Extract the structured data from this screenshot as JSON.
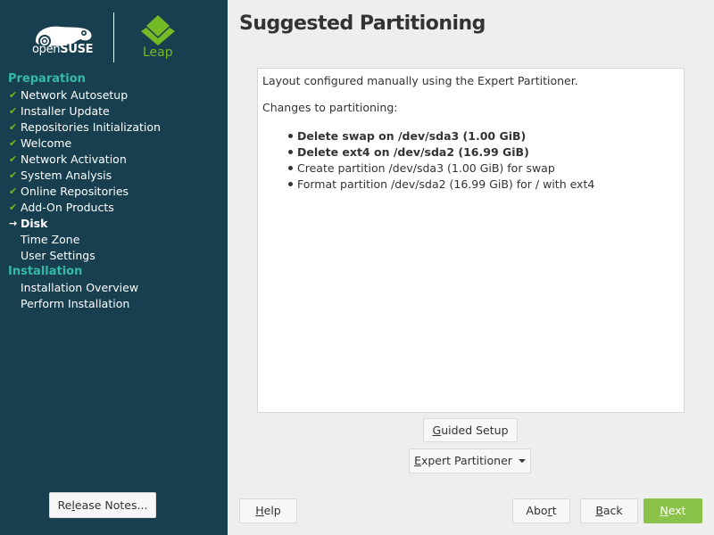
{
  "branding": {
    "opensuse_text_light": "open",
    "opensuse_text_bold": "SUSE",
    "product_name": "Leap",
    "accent_green": "#73ba25",
    "sidebar_bg": "#173f4f",
    "section_color": "#35b9ab"
  },
  "sidebar": {
    "sections": [
      {
        "title": "Preparation",
        "steps": [
          {
            "label": "Network Autosetup",
            "status": "done"
          },
          {
            "label": "Installer Update",
            "status": "done"
          },
          {
            "label": "Repositories Initialization",
            "status": "done"
          },
          {
            "label": "Welcome",
            "status": "done"
          },
          {
            "label": "Network Activation",
            "status": "done"
          },
          {
            "label": "System Analysis",
            "status": "done"
          },
          {
            "label": "Online Repositories",
            "status": "done"
          },
          {
            "label": "Add-On Products",
            "status": "done"
          },
          {
            "label": "Disk",
            "status": "current"
          },
          {
            "label": "Time Zone",
            "status": "pending"
          },
          {
            "label": "User Settings",
            "status": "pending"
          }
        ]
      },
      {
        "title": "Installation",
        "steps": [
          {
            "label": "Installation Overview",
            "status": "pending"
          },
          {
            "label": "Perform Installation",
            "status": "pending"
          }
        ]
      }
    ],
    "release_notes_pre": "Re",
    "release_notes_ul": "l",
    "release_notes_post": "ease Notes..."
  },
  "main": {
    "title": "Suggested Partitioning",
    "summary": "Layout configured manually using the Expert Partitioner.",
    "changes_heading": "Changes to partitioning:",
    "changes": [
      {
        "text": "Delete swap on /dev/sda3 (1.00 GiB)",
        "bold": true
      },
      {
        "text": "Delete ext4 on /dev/sda2 (16.99 GiB)",
        "bold": true
      },
      {
        "text": "Create partition /dev/sda3 (1.00 GiB) for swap",
        "bold": false
      },
      {
        "text": "Format partition /dev/sda2 (16.99 GiB) for / with ext4",
        "bold": false
      }
    ],
    "guided_setup": {
      "ul": "G",
      "rest": "uided Setup"
    },
    "expert_partitioner": {
      "ul": "E",
      "rest": "xpert Partitioner"
    }
  },
  "footer": {
    "help": {
      "ul": "H",
      "rest": "elp"
    },
    "abort": {
      "pre": "Abo",
      "ul": "r",
      "post": "t"
    },
    "back": {
      "ul": "B",
      "rest": "ack"
    },
    "next": {
      "ul": "N",
      "rest": "ext"
    },
    "next_color": "#8bc34a"
  }
}
